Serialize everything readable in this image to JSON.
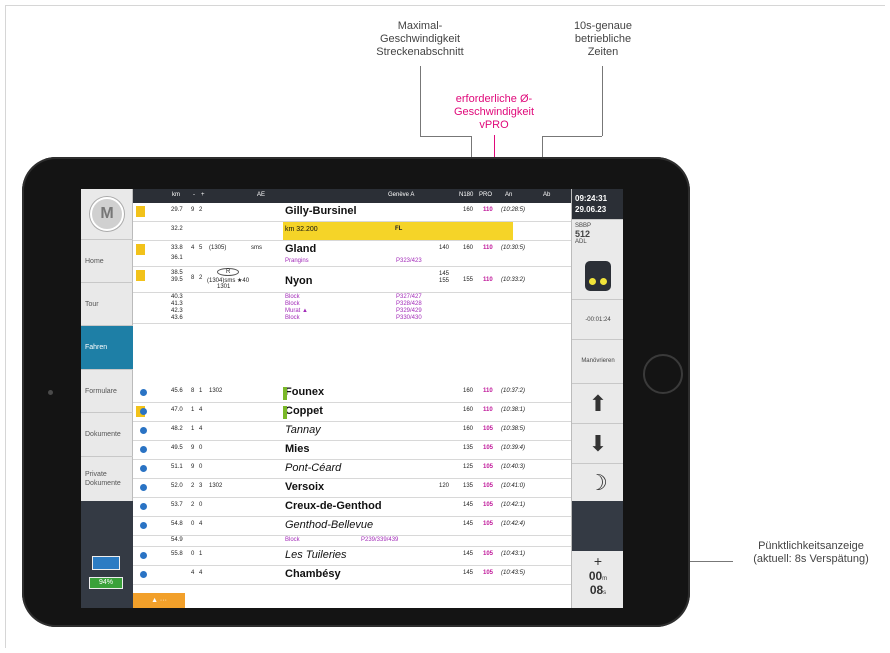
{
  "callouts": {
    "max_speed": [
      "Maximal-",
      "Geschwindigkeit",
      "Streckenabschnitt"
    ],
    "vpro": [
      "erforderliche Ø-",
      "Geschwindigkeit",
      "vPRO"
    ],
    "times": [
      "10s-genaue",
      "betriebliche",
      "Zeiten"
    ],
    "punctuality": [
      "Pünktlichkeitsanzeige",
      "(aktuell: 8s Verspätung)"
    ]
  },
  "nav": {
    "logo": "M",
    "items": [
      "Home",
      "Tour",
      "Fahren",
      "Formulare",
      "Dokumente",
      "Private Dokumente"
    ],
    "battery": "94%"
  },
  "header": {
    "km": "km",
    "minus": "-",
    "plus": "+",
    "ae": "AE",
    "route": "Genève A",
    "n": "N180",
    "pro": "PRO",
    "an": "An",
    "ab": "Ab"
  },
  "rows": [
    {
      "km": "29.7",
      "a": "9",
      "b": "2",
      "name": "Gilly-Bursinel",
      "n": "160",
      "pro": "110",
      "time": "(10:28:5)"
    },
    {
      "km": "32.2",
      "name": "km 32.200",
      "fl": "FL"
    },
    {
      "km": "33.8",
      "a": "4",
      "b": "5",
      "ae": "(1305)",
      "ae2": "sms",
      "name": "Gland",
      "vmax": "140",
      "n": "160",
      "pro": "110",
      "time": "(10:30:5)",
      "sub": "Prangins",
      "subref": "P323/423",
      "km2": "36.1"
    },
    {
      "km": "38.5",
      "km2": "39.5",
      "a": "8",
      "b": "2",
      "ae": "R",
      "ae2": "(1304)sms ★40",
      "ae3": "1301",
      "name": "Nyon",
      "vmax": "145",
      "vmax2": "155",
      "n": "155",
      "pro": "110",
      "time": "(10:33:2)"
    },
    {
      "blocks": [
        "Block",
        "Block",
        "Murat ▲",
        "Block"
      ],
      "refs": [
        "P327/427",
        "P328/428",
        "P329/429",
        "P330/430"
      ],
      "kms": [
        "40.3",
        "41.3",
        "42.3",
        "43.6"
      ]
    },
    {
      "km": "45.6",
      "a": "8",
      "b": "1",
      "ae": "1302",
      "name": "Founex",
      "n": "160",
      "pro": "110",
      "time": "(10:37:2)"
    },
    {
      "km": "47.0",
      "a": "1",
      "b": "4",
      "name": "Coppet",
      "n": "160",
      "pro": "110",
      "time": "(10:38:1)"
    },
    {
      "km": "48.2",
      "a": "1",
      "b": "4",
      "name": "Tannay",
      "n": "160",
      "pro": "105",
      "time": "(10:38:5)"
    },
    {
      "km": "49.5",
      "a": "9",
      "b": "0",
      "name": "Mies",
      "n": "135",
      "pro": "105",
      "time": "(10:39:4)"
    },
    {
      "km": "51.1",
      "a": "9",
      "b": "0",
      "name": "Pont-Céard",
      "n": "125",
      "pro": "105",
      "time": "(10:40:3)"
    },
    {
      "km": "52.0",
      "a": "2",
      "b": "3",
      "ae": "1302",
      "name": "Versoix",
      "vmax": "120",
      "n": "135",
      "pro": "105",
      "time": "(10:41:0)"
    },
    {
      "km": "53.7",
      "a": "2",
      "b": "0",
      "name": "Creux-de-Genthod",
      "n": "145",
      "pro": "105",
      "time": "(10:42:1)"
    },
    {
      "km": "54.8",
      "a": "0",
      "b": "4",
      "name": "Genthod-Bellevue",
      "n": "145",
      "pro": "105",
      "time": "(10:42:4)"
    },
    {
      "km": "54.9",
      "sub": "Block",
      "subref": "P239/339/439"
    },
    {
      "km": "55.8",
      "a": "0",
      "b": "1",
      "name": "Les Tuileries",
      "n": "145",
      "pro": "105",
      "time": "(10:43:1)"
    },
    {
      "km": "",
      "a": "4",
      "b": "4",
      "name": "Chambésy",
      "n": "145",
      "pro": "105",
      "time": "(10:43:5)"
    }
  ],
  "right_panel": {
    "clock": "09:24:31",
    "date": "29.06.23",
    "sbb": "SBBP",
    "train": "512",
    "adl": "ADL",
    "delay": "-00:01:24",
    "maneuver": "Manövrieren",
    "punct_plus": "+",
    "punct_min": "00",
    "punct_min_unit": "m",
    "punct_sec": "08",
    "punct_sec_unit": "s"
  }
}
